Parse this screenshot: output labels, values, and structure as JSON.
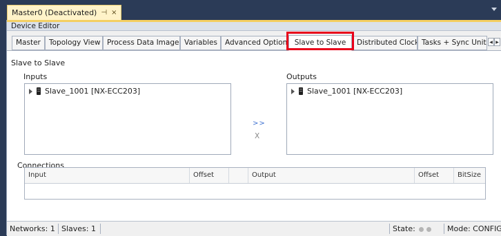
{
  "doc_tab": {
    "title": "Master0 (Deactivated)",
    "pin_icon": "⊣",
    "close_icon": "×"
  },
  "editor": {
    "header": "Device Editor"
  },
  "tabs": [
    {
      "label": "Master"
    },
    {
      "label": "Topology View"
    },
    {
      "label": "Process Data Image"
    },
    {
      "label": "Variables"
    },
    {
      "label": "Advanced Options"
    },
    {
      "label": "Slave to Slave"
    },
    {
      "label": "Distributed Clocks"
    },
    {
      "label": "Tasks + Sync Unit"
    }
  ],
  "active_tab": "Slave to Slave",
  "tab_scroll": {
    "left": "◀",
    "right": "▶"
  },
  "content": {
    "section_title": "Slave to Slave",
    "inputs_label": "Inputs",
    "outputs_label": "Outputs",
    "inputs_items": [
      {
        "label": "Slave_1001 [NX-ECC203]"
      }
    ],
    "outputs_items": [
      {
        "label": "Slave_1001 [NX-ECC203]"
      }
    ],
    "map_button": ">>",
    "unmap_button": "X",
    "connections_label": "Connections",
    "columns": [
      "Input",
      "Offset",
      "",
      "Output",
      "Offset",
      "BitSize"
    ]
  },
  "statusbar": {
    "networks": "Networks: 1",
    "slaves": "Slaves: 1",
    "state_label": "State:",
    "mode": "Mode: CONFIG"
  },
  "colors": {
    "highlight": "#e8001a",
    "doc_tab_bg": "#fff3c9",
    "frame": "#2b3b57"
  }
}
